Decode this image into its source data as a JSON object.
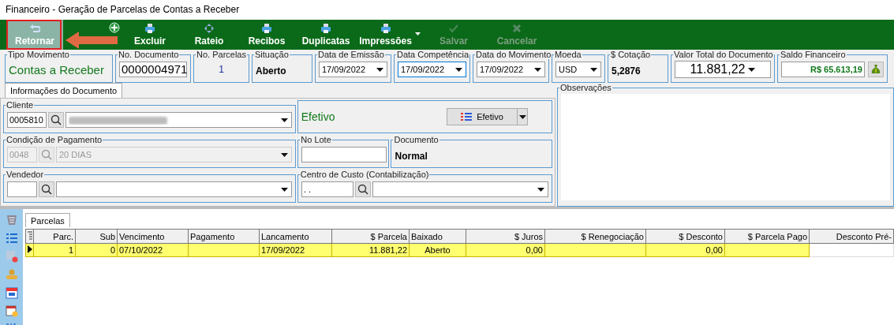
{
  "window": {
    "title": "Financeiro - Geração de Parcelas de Contas a Receber"
  },
  "toolbar": [
    {
      "kind": "button",
      "label": "Retornar",
      "selected": true,
      "disabled": false,
      "menu": false
    },
    {
      "kind": "icon",
      "selected": false,
      "disabled": false,
      "menu": false
    },
    {
      "kind": "button",
      "label": "Excluir",
      "selected": false,
      "disabled": false,
      "menu": false
    },
    {
      "kind": "button",
      "label": "Rateio",
      "selected": false,
      "disabled": false,
      "menu": false
    },
    {
      "kind": "button",
      "label": "Recibos",
      "selected": false,
      "disabled": false,
      "menu": false
    },
    {
      "kind": "button",
      "label": "Duplicatas",
      "selected": false,
      "disabled": false,
      "menu": false
    },
    {
      "kind": "button",
      "label": "Impressões",
      "selected": false,
      "disabled": false,
      "menu": true
    },
    {
      "kind": "button",
      "label": "Salvar",
      "selected": false,
      "disabled": true,
      "menu": false
    },
    {
      "kind": "button",
      "label": "Cancelar",
      "selected": false,
      "disabled": true,
      "menu": false
    }
  ],
  "annotation": {
    "kind": "box-and-arrow"
  },
  "header_fields": [
    {
      "label": "Tipo Movimento",
      "kind": "title",
      "value": "Contas a Receber",
      "focused": false
    },
    {
      "label": "No. Documento",
      "kind": "input",
      "value": "0000004971",
      "focused": false
    },
    {
      "label": "No. Parcelas",
      "kind": "count",
      "value": "1",
      "focused": false
    },
    {
      "label": "Situação",
      "kind": "bold",
      "value": "Aberto",
      "focused": false
    },
    {
      "label": "Data de Emissão",
      "kind": "combo",
      "value": "17/09/2022",
      "focused": false
    },
    {
      "label": "Data Competência",
      "kind": "combo",
      "value": "17/09/2022",
      "focused": true
    },
    {
      "label": "Data do Movimento",
      "kind": "combo",
      "value": "17/09/2022",
      "focused": false
    },
    {
      "label": "Moeda",
      "kind": "combo",
      "value": "USD",
      "focused": false
    },
    {
      "label": "$ Cotação",
      "kind": "bold",
      "value": "5,2876",
      "focused": false
    },
    {
      "label": "Valor Total do Documento",
      "kind": "bigcombo",
      "value": "11.881,22",
      "focused": false
    },
    {
      "label": "Saldo Financeiro",
      "kind": "money",
      "value": "R$ 65.613,19",
      "focused": false
    }
  ],
  "document_tabs": [
    {
      "label": "Informações do Documento",
      "selected": true
    }
  ],
  "cliente": {
    "label": "Cliente",
    "code": "0005810",
    "name_redacted": true
  },
  "tipo": {
    "value": "Efetivo",
    "button": "Efetivo"
  },
  "condicao": {
    "label": "Condição de Pagamento",
    "code": "0048",
    "value": "20 DIAS",
    "disabled": true
  },
  "lote": {
    "label": "No Lote"
  },
  "documento": {
    "label": "Documento",
    "value": "Normal"
  },
  "vendedor": {
    "label": "Vendedor"
  },
  "centro_custo": {
    "label": "Centro de Custo (Contabilização)",
    "code": " .  ."
  },
  "observacoes": {
    "label": "Observações"
  },
  "grid_tabs": [
    {
      "label": "Parcelas",
      "selected": true
    }
  ],
  "table": {
    "columns": [
      {
        "label": "Parc.",
        "kind": "number"
      },
      {
        "label": "Sub",
        "kind": "number"
      },
      {
        "label": "Vencimento",
        "kind": "text"
      },
      {
        "label": "Pagamento",
        "kind": "text"
      },
      {
        "label": "Lancamento",
        "kind": "text"
      },
      {
        "label": "$ Parcela",
        "kind": "number"
      },
      {
        "label": "Baixado",
        "kind": "text"
      },
      {
        "label": "$ Juros",
        "kind": "number"
      },
      {
        "label": "$ Renegociação",
        "kind": "number"
      },
      {
        "label": "$ Desconto",
        "kind": "number"
      },
      {
        "label": "$ Parcela Pago",
        "kind": "number"
      },
      {
        "label": "Desconto Pré-",
        "kind": "number"
      }
    ],
    "rows": [
      {
        "selected": true,
        "cells": [
          "1",
          "0",
          "07/10/2022",
          null,
          "17/09/2022",
          "11.881,22",
          "Aberto",
          "0,00",
          null,
          "0,00",
          null,
          null
        ]
      }
    ]
  }
}
